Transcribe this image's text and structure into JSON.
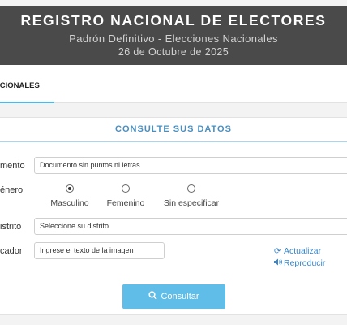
{
  "header": {
    "title": "REGISTRO NACIONAL DE ELECTORES",
    "subtitle": "Padrón Definitivo - Elecciones Nacionales",
    "date": "26 de Octubre de 2025"
  },
  "tabs": [
    {
      "label": "NACIONALES",
      "active": true
    }
  ],
  "panel": {
    "title": "CONSULTE SUS DATOS"
  },
  "form": {
    "documento_label": "mento",
    "documento_value": "Documento sin puntos ni letras",
    "genero_label": "énero",
    "genero_options": [
      {
        "label": "Masculino",
        "selected": true
      },
      {
        "label": "Femenino",
        "selected": false
      },
      {
        "label": "Sin especificar",
        "selected": false
      }
    ],
    "distrito_label": "istrito",
    "distrito_value": "Seleccione su distrito",
    "captcha_label": "cador",
    "captcha_value": "Ingrese el texto de la imagen",
    "actualizar_label": "Actualizar",
    "reproducir_label": "Reproducir",
    "submit_label": "Consultar"
  },
  "colors": {
    "accent": "#5fbde8",
    "header_bg": "#4a4a4a",
    "link": "#3a86c8"
  }
}
